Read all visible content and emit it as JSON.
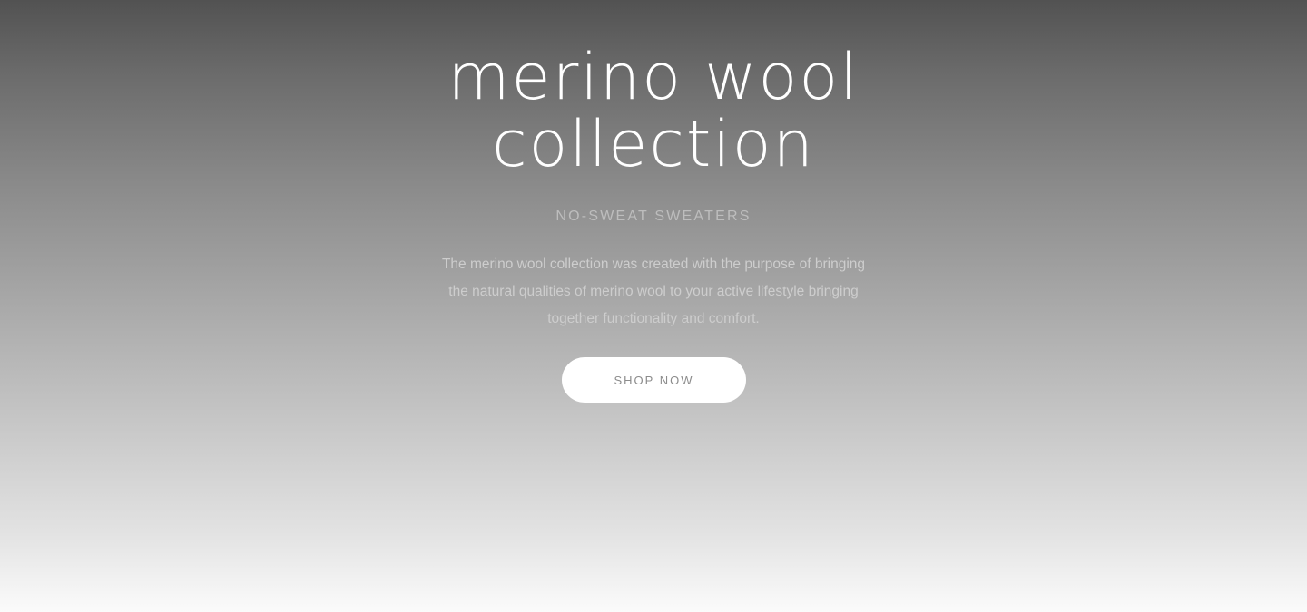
{
  "hero": {
    "title_line1": "merino wool",
    "title_line2": "collection",
    "subtitle": "NO-SWEAT SWEATERS",
    "description": "The merino wool collection was created with the purpose of bringing the natural qualities of merino wool to your active lifestyle bringing together functionality and comfort.",
    "cta_label": "SHOP NOW"
  },
  "colors": {
    "gradient_top": "#525252",
    "gradient_bottom": "#fbfbfb",
    "title": "#ffffff",
    "button_bg": "#ffffff",
    "button_text": "#8c8c8c"
  }
}
